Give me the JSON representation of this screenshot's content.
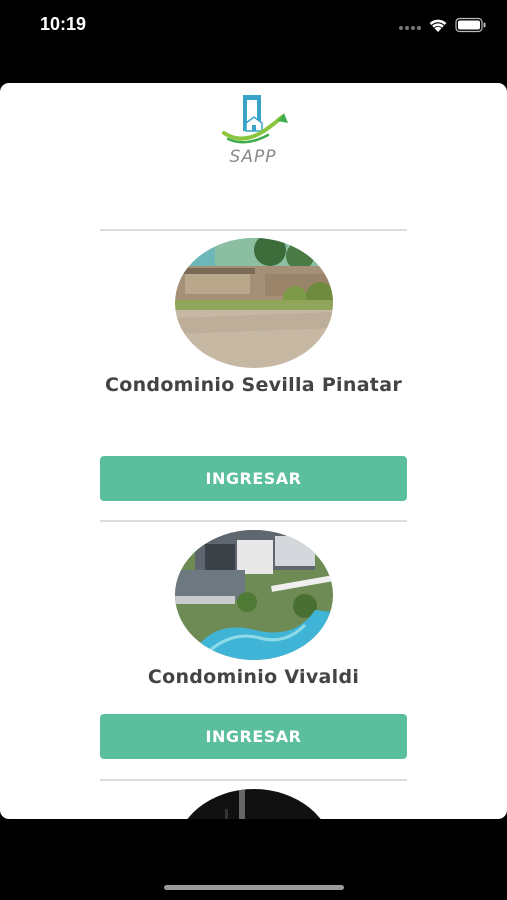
{
  "status_bar": {
    "time": "10:19",
    "icons": [
      "signal-icon",
      "wifi-icon",
      "battery-icon"
    ]
  },
  "brand": {
    "logo_text": "SAPP",
    "accent_color": "#5bbf9e"
  },
  "condominiums": [
    {
      "title": "Condominio Sevilla Pinatar",
      "button_label": "INGRESAR"
    },
    {
      "title": "Condominio Vivaldi",
      "button_label": "INGRESAR"
    }
  ]
}
